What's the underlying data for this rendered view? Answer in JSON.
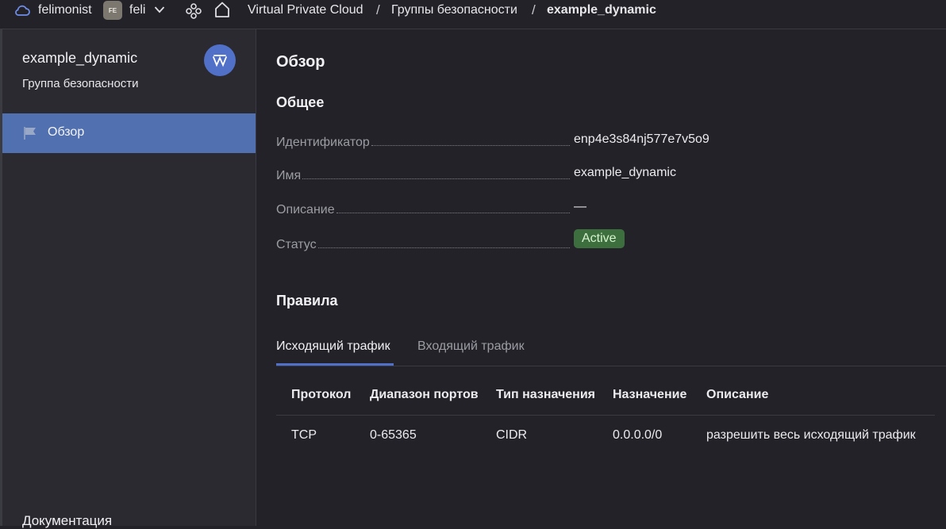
{
  "topbar": {
    "account": "felimonist",
    "org_badge": "FE",
    "org_name": "feli",
    "breadcrumbs": [
      "Virtual Private Cloud",
      "Группы безопасности",
      "example_dynamic"
    ],
    "separator": "/",
    "icons": [
      "cloud-icon",
      "chevron-down-icon",
      "nodes-icon",
      "home-icon"
    ]
  },
  "sidebar": {
    "title": "example_dynamic",
    "subtitle": "Группа безопасности",
    "avatar_icon": "security-group-icon",
    "items": [
      {
        "label": "Обзор",
        "icon": "flag-icon",
        "active": true
      }
    ],
    "footer": "Документация"
  },
  "main": {
    "heading": "Обзор",
    "general": {
      "heading": "Общее",
      "fields": [
        {
          "key": "Идентификатор",
          "value": "enp4e3s84nj577e7v5o9"
        },
        {
          "key": "Имя",
          "value": "example_dynamic"
        },
        {
          "key": "Описание",
          "value": "—"
        },
        {
          "key": "Статус",
          "value": "Active"
        }
      ]
    },
    "rules": {
      "heading": "Правила",
      "tabs": [
        {
          "label": "Исходящий трафик",
          "active": true
        },
        {
          "label": "Входящий трафик",
          "active": false
        }
      ],
      "columns": [
        "Протокол",
        "Диапазон портов",
        "Тип назначения",
        "Назначение",
        "Описание"
      ],
      "rows": [
        [
          "TCP",
          "0-65365",
          "CIDR",
          "0.0.0.0/0",
          "разрешить весь исходящий трафик"
        ]
      ]
    }
  },
  "colors": {
    "background": "#222228",
    "sidebar": "#2a2a30",
    "accent": "#5171c9",
    "active_item": "#5170b0",
    "status_active": "#3d6f3e"
  }
}
